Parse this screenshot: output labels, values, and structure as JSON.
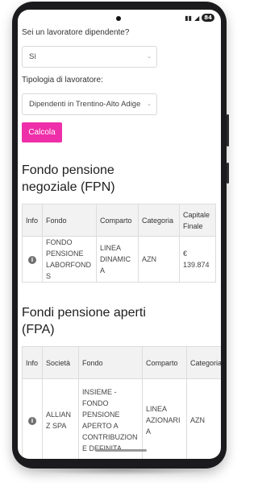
{
  "status": {
    "battery": "84",
    "network_glyphs": "▮▮ ▴"
  },
  "form": {
    "q1_label": "Sei un lavoratore dipendente?",
    "q1_value": "Sì",
    "q2_label": "Tipologia di lavoratore:",
    "q2_value": "Dipendenti in Trentino-Alto Adige",
    "submit_label": "Calcola"
  },
  "fpn": {
    "title": "Fondo pensione negoziale (FPN)",
    "headers": [
      "Info",
      "Fondo",
      "Comparto",
      "Categoria",
      "Capitale Finale"
    ],
    "row": {
      "fondo": "FONDO PENSIONE LABORFONDS",
      "comparto": "LINEA DINAMICA",
      "categoria": "AZN",
      "capitale": "€ 139.874"
    }
  },
  "fpa": {
    "title": "Fondi pensione aperti (FPA)",
    "headers": [
      "Info",
      "Società",
      "Fondo",
      "Comparto",
      "Categoria"
    ],
    "row": {
      "societa": "ALLIANZ SPA",
      "fondo": "INSIEME - FONDO PENSIONE APERTO A CONTRIBUZIONE DEFINITA",
      "comparto": "LINEA AZIONARIA",
      "categoria": "AZN"
    }
  },
  "icons": {
    "info": "info-icon",
    "dropdown": "chevron-down-icon"
  }
}
